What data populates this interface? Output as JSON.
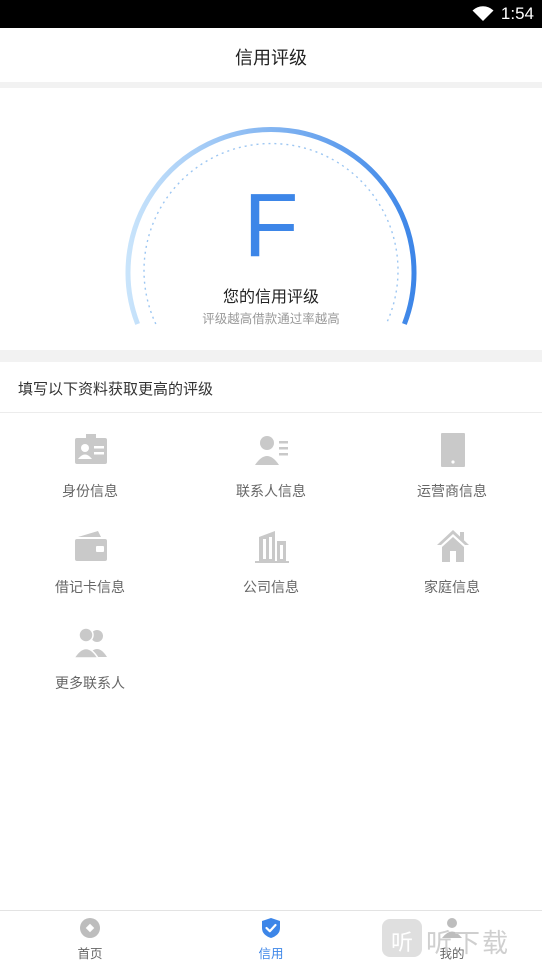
{
  "status_bar": {
    "time": "1:54",
    "wifi_icon": "wifi-icon"
  },
  "header": {
    "title": "信用评级"
  },
  "rating": {
    "grade": "F",
    "label": "您的信用评级",
    "subtitle": "评级越高借款通过率越高",
    "colors": {
      "arc_start": "#c9e4fb",
      "arc_end": "#3d86e8",
      "grade": "#3d86e8"
    }
  },
  "section": {
    "title": "填写以下资料获取更高的评级"
  },
  "items": [
    {
      "label": "身份信息",
      "icon": "id-card-icon"
    },
    {
      "label": "联系人信息",
      "icon": "contact-icon"
    },
    {
      "label": "运营商信息",
      "icon": "phone-icon"
    },
    {
      "label": "借记卡信息",
      "icon": "card-icon"
    },
    {
      "label": "公司信息",
      "icon": "building-icon"
    },
    {
      "label": "家庭信息",
      "icon": "home-icon"
    },
    {
      "label": "更多联系人",
      "icon": "people-icon"
    }
  ],
  "tabs": [
    {
      "label": "首页",
      "icon": "home-tab-icon",
      "active": false
    },
    {
      "label": "信用",
      "icon": "shield-check-icon",
      "active": true
    },
    {
      "label": "我的",
      "icon": "user-icon",
      "active": false
    }
  ],
  "watermark": {
    "badge": "听",
    "text": "听下载"
  },
  "colors": {
    "accent": "#3d86e8",
    "icon_gray": "#c9c9c9",
    "text_gray": "#666666"
  }
}
